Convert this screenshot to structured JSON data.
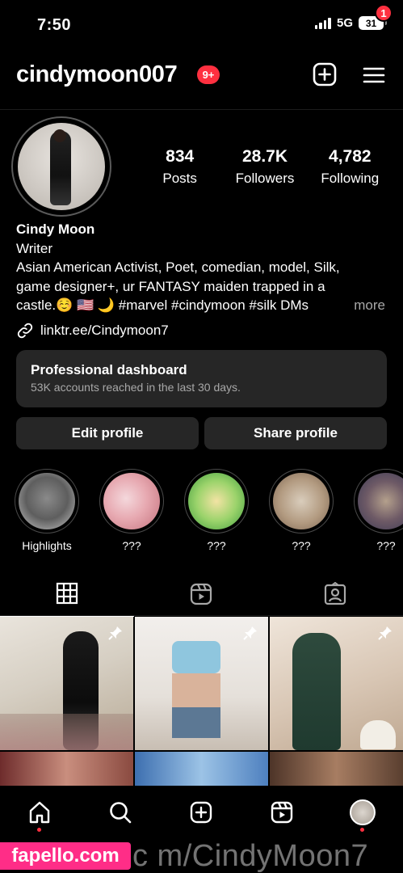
{
  "status": {
    "time": "7:50",
    "network": "5G",
    "battery": "31"
  },
  "header": {
    "username": "cindymoon007",
    "notif_badge": "9+",
    "menu_badge": "1"
  },
  "stats": [
    {
      "value": "834",
      "label": "Posts"
    },
    {
      "value": "28.7K",
      "label": "Followers"
    },
    {
      "value": "4,782",
      "label": "Following"
    }
  ],
  "bio": {
    "name": "Cindy Moon",
    "category": "Writer",
    "line1": "Asian American Activist, Poet, comedian, model, Silk,",
    "line2": "game designer+, ur FANTASY maiden trapped in a",
    "line3": "castle.☺️ 🇺🇸 🌙 #marvel #cindymoon #silk DMs",
    "more": "more",
    "link": "linktr.ee/Cindymoon7"
  },
  "dashboard": {
    "title": "Professional dashboard",
    "subtitle": "53K accounts reached in the last 30 days."
  },
  "buttons": {
    "edit": "Edit profile",
    "share": "Share profile"
  },
  "highlights": [
    {
      "label": "Highlights"
    },
    {
      "label": "???"
    },
    {
      "label": "???"
    },
    {
      "label": "???"
    },
    {
      "label": "???"
    }
  ],
  "icons": {
    "add": "plus-square-icon",
    "menu": "hamburger-menu-icon",
    "grid": "grid-icon",
    "reels": "reels-icon",
    "tagged": "tagged-user-icon",
    "pin": "pin-icon",
    "home": "home-icon",
    "search": "search-icon",
    "create": "create-icon"
  },
  "colors": {
    "accent_red": "#ff3040",
    "card_bg": "#262626",
    "watermark_pink": "#ff2d87"
  },
  "watermark": {
    "logo": "fapello.com",
    "text": "c m/CindyMoon7"
  }
}
